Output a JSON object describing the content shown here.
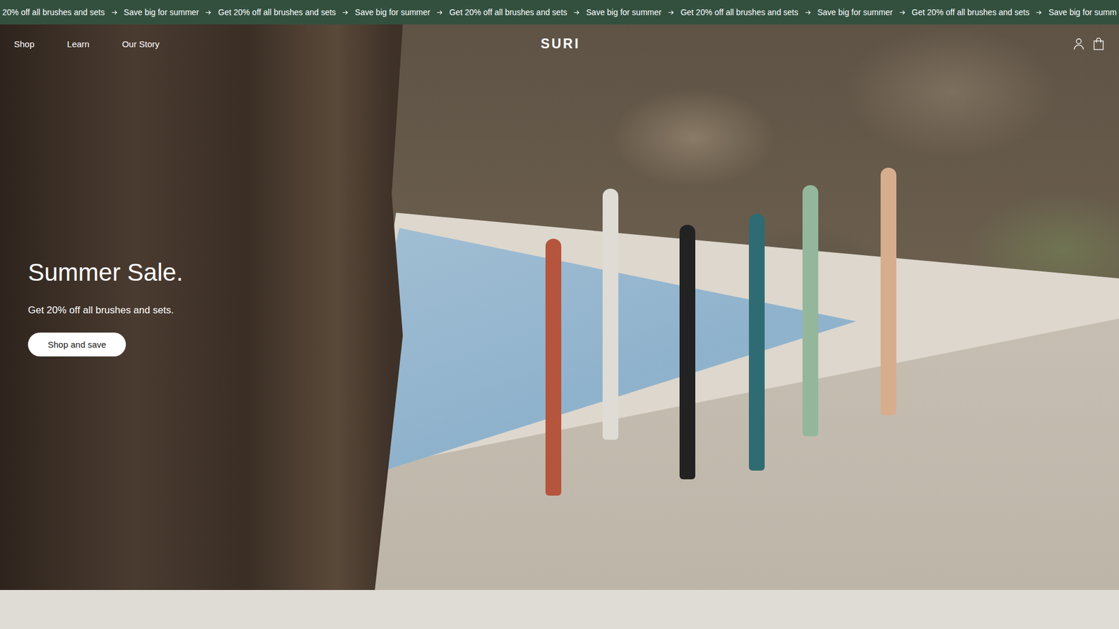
{
  "announcement_bar": {
    "items": [
      "20% off all brushes and sets",
      "Save big for summer",
      "Get 20% off all brushes and sets",
      "Save big for summer",
      "Get 20% off all brushes and sets",
      "Save big for summer",
      "Get 20% off all brushes and sets",
      "Save big for summer",
      "Get 20% off all brushes and sets",
      "Save big for summ"
    ]
  },
  "nav": {
    "links": [
      "Shop",
      "Learn",
      "Our Story"
    ],
    "logo": "SURI"
  },
  "hero": {
    "title": "Summer Sale.",
    "subtitle": "Get 20% off all brushes and sets.",
    "button": "Shop and save"
  }
}
